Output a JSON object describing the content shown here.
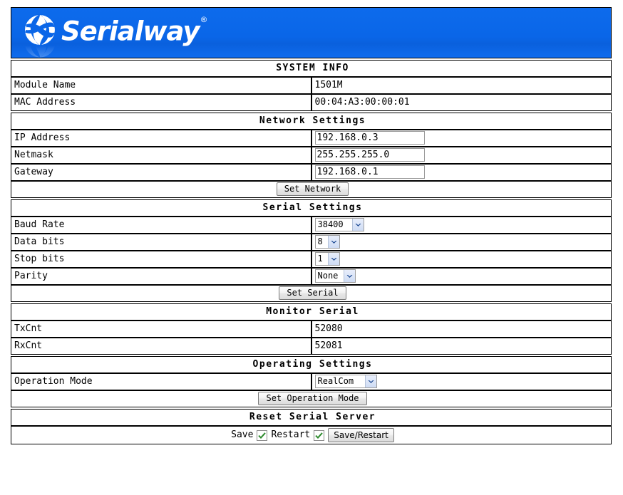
{
  "brand": {
    "name": "Serialway",
    "registered_mark": "®",
    "banner_color": "#0a66e8"
  },
  "colors": {
    "section_header_bg": "#0000ff",
    "section_header_text": "#ffffff",
    "page_bg": "#ffffff",
    "border": "#000000",
    "check_mark": "#2e8b2e"
  },
  "sections": {
    "system_info": {
      "title": "SYSTEM INFO",
      "rows": [
        {
          "label": "Module Name",
          "value": "1501M"
        },
        {
          "label": "MAC Address",
          "value": "00:04:A3:00:00:01"
        }
      ]
    },
    "network_settings": {
      "title": "Network Settings",
      "fields": [
        {
          "label": "IP Address",
          "value": "192.168.0.3"
        },
        {
          "label": "Netmask",
          "value": "255.255.255.0"
        },
        {
          "label": "Gateway",
          "value": "192.168.0.1"
        }
      ],
      "button": "Set Network"
    },
    "serial_settings": {
      "title": "Serial Settings",
      "fields": [
        {
          "label": "Baud Rate",
          "value": "38400"
        },
        {
          "label": "Data bits",
          "value": "8"
        },
        {
          "label": "Stop bits",
          "value": "1"
        },
        {
          "label": "Parity",
          "value": "None"
        }
      ],
      "button": "Set Serial"
    },
    "monitor_serial": {
      "title": "Monitor Serial",
      "rows": [
        {
          "label": "TxCnt",
          "value": "52080"
        },
        {
          "label": "RxCnt",
          "value": "52081"
        }
      ]
    },
    "operating_settings": {
      "title": "Operating Settings",
      "fields": [
        {
          "label": "Operation Mode",
          "value": "RealCom"
        }
      ],
      "button": "Set Operation Mode"
    },
    "reset_serial_server": {
      "title": "Reset Serial Server",
      "save_label": "Save",
      "save_checked": true,
      "restart_label": "Restart",
      "restart_checked": true,
      "button": "Save/Restart"
    }
  }
}
